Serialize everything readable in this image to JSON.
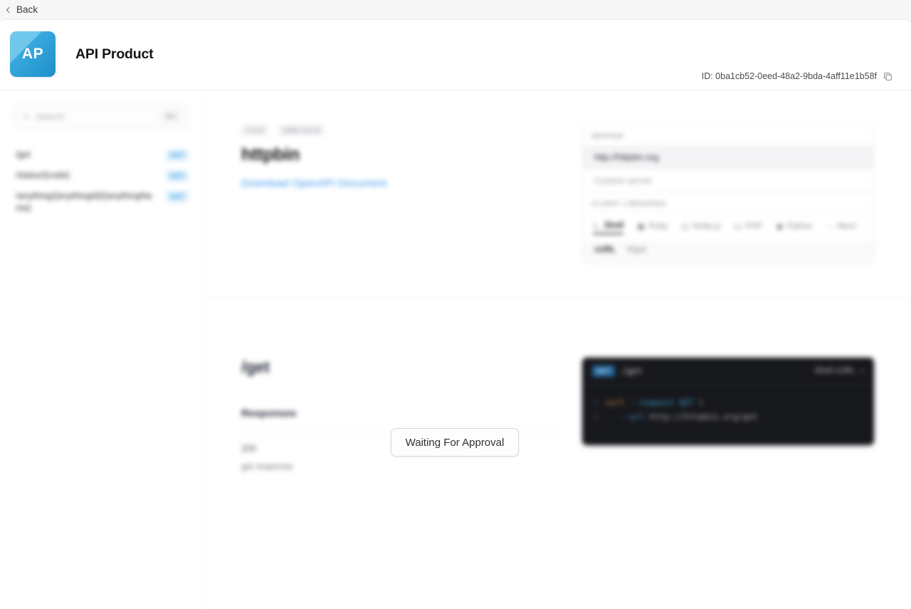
{
  "topbar": {
    "back_label": "Back",
    "back_icon": "chevron-left-icon"
  },
  "header": {
    "logo_initials": "AP",
    "title": "API Product",
    "id_label": "ID: 0ba1cb52-0eed-48a2-9bda-4aff11e1b58f",
    "copy_icon": "copy-icon",
    "logo_color": "#2e9fd6"
  },
  "sidebar": {
    "search": {
      "placeholder": "Search",
      "icon": "search-icon",
      "shortcut": "⌘K"
    },
    "items": [
      {
        "label": "/get",
        "method": "GET"
      },
      {
        "label": "/status/{code}",
        "method": "GET"
      },
      {
        "label": "/anything/{anythingId}/{anythingName}",
        "method": "GET"
      }
    ]
  },
  "doc": {
    "meta": [
      "1.0.0",
      "OAS 3.0.3"
    ],
    "title": "httpbin",
    "download_link": "Download OpenAPI Document",
    "server_panel": {
      "caption": "SERVER",
      "selected": "http://httpbin.org",
      "custom": "Custom server"
    },
    "libraries_panel": {
      "caption": "CLIENT LIBRARIES",
      "items": [
        {
          "label": "Shell",
          "icon": "terminal-icon",
          "active": true
        },
        {
          "label": "Ruby",
          "icon": "ruby-icon",
          "active": false
        },
        {
          "label": "Node.js",
          "icon": "node-icon",
          "active": false
        },
        {
          "label": "PHP",
          "icon": "php-icon",
          "active": false
        },
        {
          "label": "Python",
          "icon": "python-icon",
          "active": false
        },
        {
          "label": "More",
          "icon": "ellipsis-icon",
          "active": false
        }
      ],
      "sub_items": [
        {
          "label": "cURL",
          "active": true
        },
        {
          "label": "Wget",
          "active": false
        }
      ]
    }
  },
  "operation": {
    "path_title": "/get",
    "responses_heading": "Responses",
    "status_code": "200",
    "status_desc": "get response"
  },
  "code_sample": {
    "method": "GET",
    "path": "/get",
    "selector": "Shell cURL",
    "selector_icon": "chevron-down-icon",
    "lines": [
      {
        "num": "1",
        "cmd": "curl",
        "flag": "--request",
        "value": "GET",
        "tail": "\\"
      },
      {
        "num": "2",
        "cmd": "",
        "flag": "--url",
        "value": "",
        "tail": "http://httpbin.org/get"
      }
    ]
  },
  "overlay": {
    "button_label": "Waiting For Approval"
  }
}
